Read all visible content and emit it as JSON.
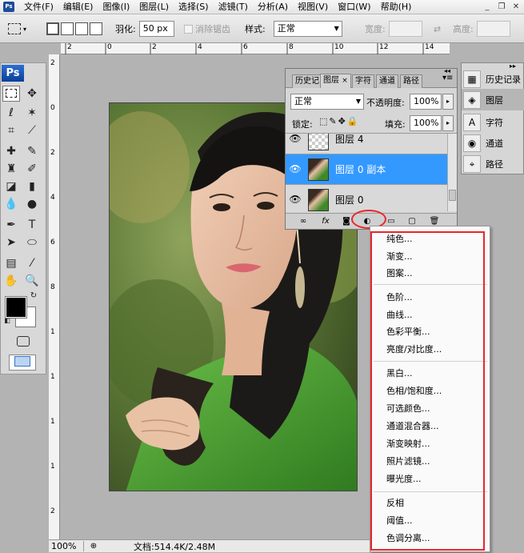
{
  "menubar": {
    "items": [
      "文件(F)",
      "编辑(E)",
      "图像(I)",
      "图层(L)",
      "选择(S)",
      "滤镜(T)",
      "分析(A)",
      "视图(V)",
      "窗口(W)",
      "帮助(H)"
    ]
  },
  "options": {
    "feather_label": "羽化:",
    "feather_value": "50 px",
    "antialias_label": "消除锯齿",
    "style_label": "样式:",
    "style_value": "正常",
    "width_label": "宽度:",
    "height_label": "高度:"
  },
  "rulers": {
    "top": [
      "2",
      "0",
      "2",
      "4",
      "6",
      "8",
      "10",
      "12",
      "14"
    ],
    "left": [
      "2",
      "0",
      "2",
      "4",
      "6",
      "8",
      "1",
      "1",
      "1",
      "1",
      "2"
    ]
  },
  "layers_panel": {
    "tabs": [
      "历史记",
      "图层",
      "字符",
      "通道",
      "路径"
    ],
    "blend_mode": "正常",
    "opacity_label": "不透明度:",
    "opacity_value": "100%",
    "lock_label": "锁定:",
    "fill_label": "填充:",
    "fill_value": "100%",
    "layers": [
      {
        "name": "图层 4"
      },
      {
        "name": "图层 0 副本"
      },
      {
        "name": "图层 0"
      }
    ]
  },
  "right_dock": {
    "items": [
      "历史记录",
      "图层",
      "字符",
      "通道",
      "路径"
    ]
  },
  "adjustment_menu": {
    "groups": [
      [
        "纯色...",
        "渐变...",
        "图案..."
      ],
      [
        "色阶...",
        "曲线...",
        "色彩平衡...",
        "亮度/对比度..."
      ],
      [
        "黑白...",
        "色相/饱和度...",
        "可选颜色...",
        "通道混合器...",
        "渐变映射...",
        "照片滤镜...",
        "曝光度..."
      ],
      [
        "反相",
        "阈值...",
        "色调分离..."
      ]
    ]
  },
  "status": {
    "zoom": "100%",
    "doc_info": "文档:514.4K/2.48M"
  },
  "colors": {
    "selected_layer": "#3399ff",
    "highlight": "#e8262c"
  }
}
